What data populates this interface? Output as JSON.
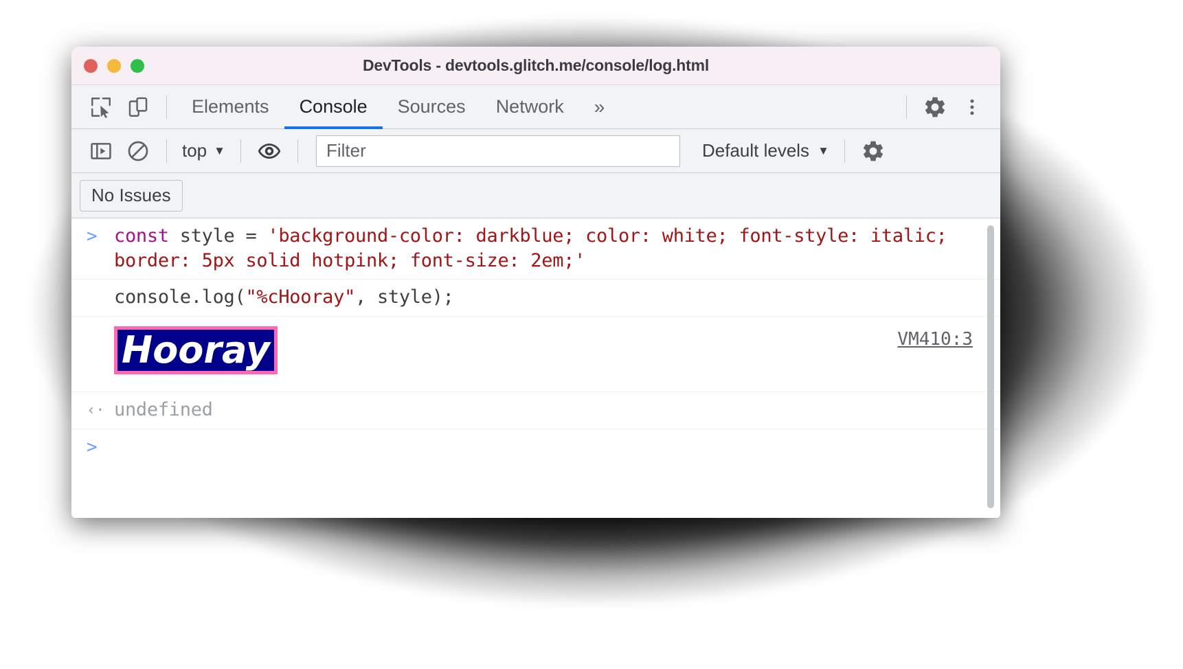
{
  "window": {
    "title": "DevTools - devtools.glitch.me/console/log.html",
    "traffic_lights": [
      "close-red",
      "minimize-yellow",
      "maximize-green"
    ]
  },
  "tabstrip": {
    "inspect_icon": "inspect-element-icon",
    "device_icon": "device-toolbar-icon",
    "tabs": [
      {
        "label": "Elements",
        "active": false
      },
      {
        "label": "Console",
        "active": true
      },
      {
        "label": "Sources",
        "active": false
      },
      {
        "label": "Network",
        "active": false
      }
    ],
    "more_label": "»",
    "settings_icon": "gear-icon",
    "menu_icon": "more-vertical-icon"
  },
  "filterbar": {
    "sidebar_icon": "console-sidebar-icon",
    "clear_icon": "clear-console-icon",
    "context_label": "top",
    "context_caret": "▼",
    "eye_icon": "live-expression-icon",
    "filter_placeholder": "Filter",
    "filter_value": "",
    "levels_label": "Default levels",
    "levels_caret": "▼",
    "console_settings_icon": "gear-icon"
  },
  "issuesbar": {
    "no_issues_label": "No Issues"
  },
  "console": {
    "rows": [
      {
        "type": "input",
        "gutter": ">",
        "tokens": [
          {
            "text": "const",
            "cls": "kw"
          },
          {
            "text": " style = ",
            "cls": "plain"
          },
          {
            "text": "'background-color: darkblue; color: white; font-style: italic; border: 5px solid hotpink; font-size: 2em;'",
            "cls": "str"
          }
        ]
      },
      {
        "type": "input",
        "gutter": "",
        "tokens": [
          {
            "text": "console.log(",
            "cls": "plain"
          },
          {
            "text": "\"%cHooray\"",
            "cls": "str"
          },
          {
            "text": ", style);",
            "cls": "plain"
          }
        ]
      },
      {
        "type": "output",
        "text": "Hooray",
        "source_link": "VM410:3",
        "style": {
          "background-color": "#00008b",
          "color": "#ffffff",
          "font-style": "italic",
          "border": "5px solid #ff69b4",
          "font-size": "2em"
        }
      },
      {
        "type": "result",
        "gutter": "‹·",
        "text": "undefined"
      },
      {
        "type": "prompt",
        "gutter": ">",
        "text": ""
      }
    ]
  },
  "colors": {
    "accent": "#1a73e8",
    "titlebar_bg": "#f8eff5",
    "toolbar_bg": "#f1f3f4",
    "keyword": "#aa0d91",
    "string": "#a31515",
    "muted": "#9aa0a6",
    "hooray_bg": "#00008b",
    "hooray_border": "#ff69b4"
  }
}
